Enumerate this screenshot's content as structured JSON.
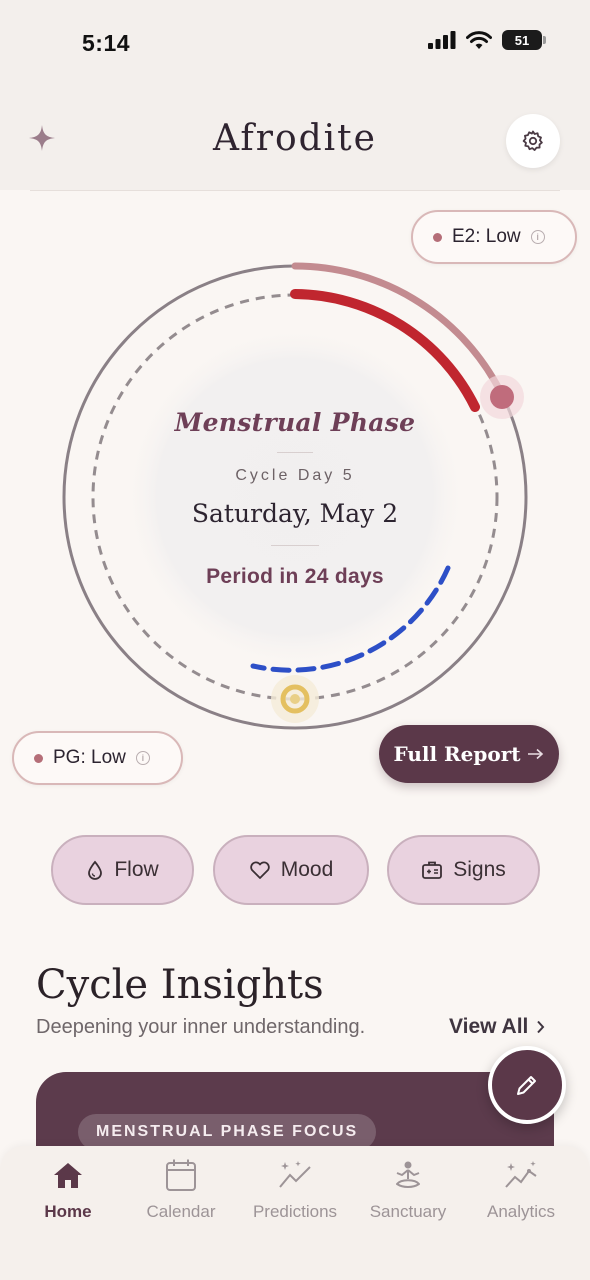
{
  "status_bar": {
    "time": "5:14",
    "battery": "51"
  },
  "header": {
    "title": "Afrodite",
    "sparkle_icon": "sparkle-icon",
    "settings_icon": "gear-icon"
  },
  "hormones": {
    "e2": {
      "label": "E2: Low",
      "dot_color": "#b56e78"
    },
    "pg": {
      "label": "PG: Low",
      "dot_color": "#b56e78"
    }
  },
  "dial": {
    "phase": "Menstrual Phase",
    "cycle_day": "Cycle Day 5",
    "date": "Saturday, May 2",
    "period_countdown": "Period in 24 days",
    "colors": {
      "period_arc": "#c0262f",
      "outer_arc": "#c38b90",
      "fertile_arc": "#2d4fc7",
      "ovulation": "#e4c061"
    }
  },
  "full_report": {
    "label": "Full Report"
  },
  "log_chips": [
    {
      "label": "Flow",
      "icon": "droplet-icon"
    },
    {
      "label": "Mood",
      "icon": "heart-icon"
    },
    {
      "label": "Signs",
      "icon": "medical-kit-icon"
    }
  ],
  "insights": {
    "title": "Cycle Insights",
    "subtitle": "Deepening your inner understanding.",
    "view_all": "View All",
    "card_badge": "MENSTRUAL PHASE FOCUS"
  },
  "fab": {
    "icon": "pencil-icon"
  },
  "bottom_nav": [
    {
      "label": "Home",
      "icon": "home-icon",
      "active": true
    },
    {
      "label": "Calendar",
      "icon": "calendar-icon",
      "active": false
    },
    {
      "label": "Predictions",
      "icon": "trend-sparkle-icon",
      "active": false
    },
    {
      "label": "Sanctuary",
      "icon": "meditation-icon",
      "active": false
    },
    {
      "label": "Analytics",
      "icon": "analytics-icon",
      "active": false
    }
  ],
  "colors": {
    "brand": "#5b3849",
    "chip_bg": "#e9d2df",
    "background": "#faf6f3"
  }
}
